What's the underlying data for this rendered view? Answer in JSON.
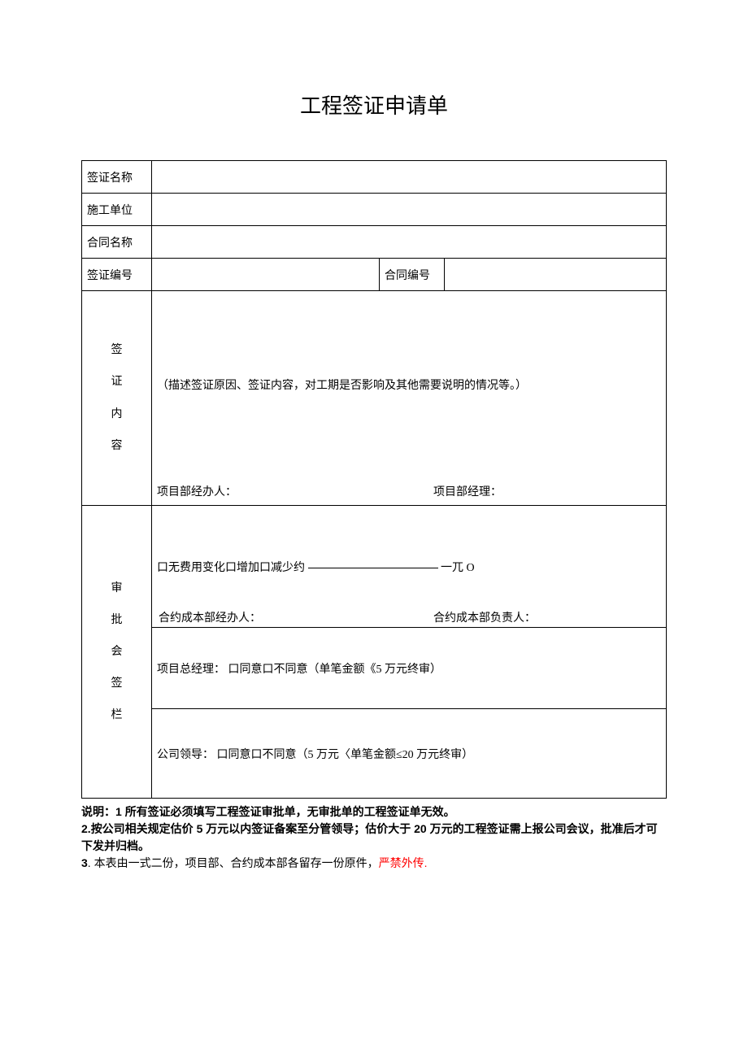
{
  "title": "工程签证申请单",
  "labels": {
    "visa_name": "签证名称",
    "contractor": "施工单位",
    "contract_name": "合同名称",
    "visa_number": "签证编号",
    "contract_number": "合同编号",
    "visa_content_v0": "签",
    "visa_content_v1": "证",
    "visa_content_v2": "内",
    "visa_content_v3": "容",
    "approval_v0": "审",
    "approval_v1": "批",
    "approval_v2": "会",
    "approval_v3": "签",
    "approval_v4": "栏"
  },
  "content": {
    "hint": "（描述签证原因、签证内容，对工期是否影响及其他需要说明的情况等。）",
    "handler": "项目部经办人：",
    "pm": "项目部经理：",
    "cost_change_line": "口无费用变化口增加口减少约",
    "cost_change_suffix": "一兀 O",
    "cost_handler": "合约成本部经办人：",
    "cost_leader": "合约成本部负责人：",
    "pm_total": "项目总经理：    口同意口不同意（单笔金额《5 万元终审）",
    "company_leader": "公司领导：      口同意口不同意（5 万元〈单笔金额≤20 万元终审）"
  },
  "notes": {
    "prefix": "说明：",
    "n1_num": "1 ",
    "n1": "所有签证必须填写工程签证审批单，无审批单的工程签证单无效。",
    "n2_num": "2.",
    "n2": "按公司相关规定估价 5 万元以内签证备案至分管领导；估价大于 20 万元的工程签证需上报公司会议，批准后才可下发并归档。",
    "n3_num": "3",
    "n3_a": ". 本表由一式二份，项目部、合约成本部各留存一份原件，",
    "n3_red": "严禁外传.",
    "n3_b": ""
  }
}
